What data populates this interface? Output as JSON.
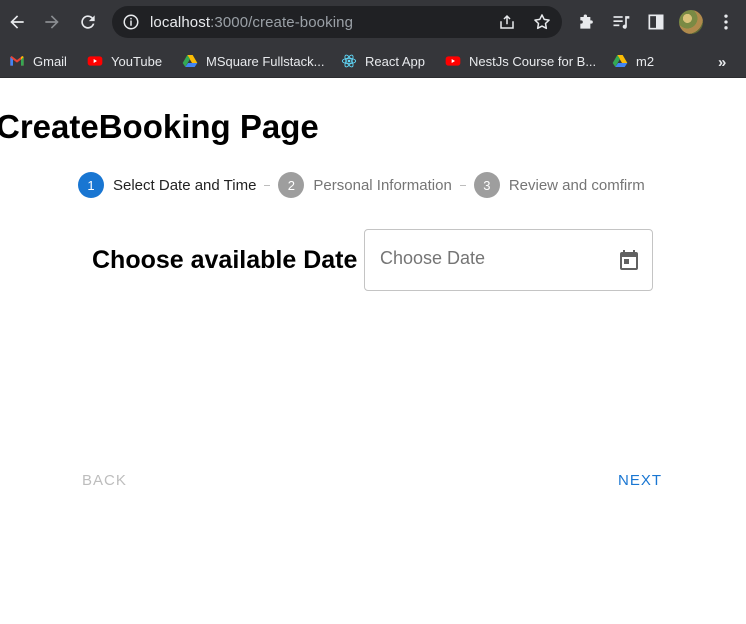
{
  "browser": {
    "url_host": "localhost",
    "url_path": ":3000/create-booking",
    "bookmarks": [
      {
        "label": "Gmail",
        "icon": "gmail-icon"
      },
      {
        "label": "YouTube",
        "icon": "youtube-icon"
      },
      {
        "label": "MSquare Fullstack...",
        "icon": "google-drive-icon"
      },
      {
        "label": "React App",
        "icon": "react-icon"
      },
      {
        "label": "NestJs Course for B...",
        "icon": "youtube-icon"
      },
      {
        "label": "m2",
        "icon": "google-drive-icon"
      }
    ],
    "more_label": "»"
  },
  "page": {
    "title": "CreateBooking Page",
    "stepper": {
      "steps": [
        {
          "number": "1",
          "label": "Select Date and Time",
          "active": true
        },
        {
          "number": "2",
          "label": "Personal Information",
          "active": false
        },
        {
          "number": "3",
          "label": "Review and comfirm",
          "active": false
        }
      ]
    },
    "date_label": "Choose available Date",
    "date_input": {
      "placeholder": "Choose Date",
      "value": ""
    },
    "back_label": "BACK",
    "next_label": "NEXT"
  },
  "colors": {
    "toolbar": "#35363a",
    "omnibox": "#202124",
    "primary": "#1976d2",
    "disabled": "#bdbdbd",
    "step_inactive": "#9e9e9e"
  }
}
